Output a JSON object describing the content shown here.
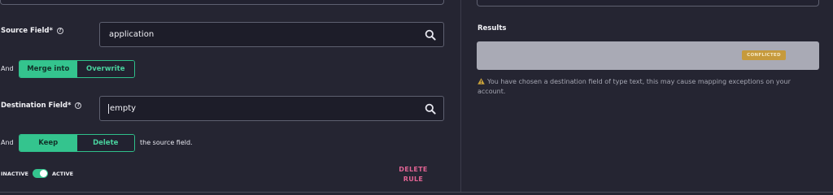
{
  "form": {
    "source_field": {
      "label": "Source Field*",
      "value": "application"
    },
    "merge_mode": {
      "and": "And",
      "options": [
        "Merge into",
        "Overwrite"
      ],
      "selected": "Merge into"
    },
    "destination_field": {
      "label": "Destination Field*",
      "value": "empty"
    },
    "keep_mode": {
      "and": "And",
      "options": [
        "Keep",
        "Delete"
      ],
      "selected": "Keep",
      "suffix": "the source field."
    },
    "status_toggle": {
      "inactive_label": "INACTIVE",
      "active_label": "ACTIVE",
      "state": "active"
    },
    "delete_rule": {
      "line1": "DELETE",
      "line2": "RULE"
    }
  },
  "results": {
    "label": "Results",
    "badge": "CONFLICTED",
    "warning": "You have chosen a destination field of type text, this may cause mapping exceptions on your account."
  },
  "colors": {
    "background": "#252532",
    "accent": "#34c48e",
    "danger": "#e06393",
    "badge": "#c69a3c",
    "warning_icon": "#c9a23a"
  },
  "icons": [
    "help-circle-icon",
    "search-icon",
    "warning-icon"
  ]
}
